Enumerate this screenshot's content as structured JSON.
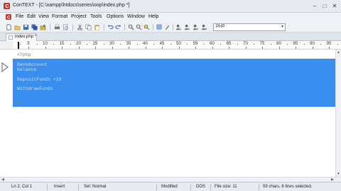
{
  "window": {
    "title": "ConTEXT - [C:\\xampp\\htdocs\\series\\oop\\index.php *]",
    "minimize": "–",
    "maximize": "□",
    "close": "✕"
  },
  "menu": {
    "items": [
      "File",
      "Edit",
      "View",
      "Format",
      "Project",
      "Tools",
      "Options",
      "Window",
      "Help"
    ]
  },
  "toolbar": {
    "icons": [
      "new-file-icon",
      "open-folder-icon",
      "save-icon",
      "save-all-icon",
      "open-project-icon",
      "print-icon",
      "print-preview-icon",
      "cut-icon",
      "copy-icon",
      "paste-icon",
      "undo-icon",
      "redo-icon",
      "find-icon",
      "replace-icon",
      "find-next-icon",
      "exec-icon",
      "user-exec-icon",
      "user-exec-1-icon",
      "user-exec-2-icon",
      "user-exec-3-icon",
      "user-exec-4-icon"
    ],
    "highlighter": {
      "value": "PHP"
    }
  },
  "tabs": [
    {
      "label": "index.php *"
    }
  ],
  "ruler": {
    "labels": [
      "5",
      "10",
      "15",
      "20",
      "25",
      "30",
      "35",
      "40",
      "45",
      "50",
      "55",
      "60",
      "65",
      "70",
      "75",
      "80",
      "85",
      "90",
      "95",
      "10"
    ]
  },
  "editor": {
    "lines": [
      {
        "text": "<?php",
        "selected": false
      },
      {
        "text": "",
        "selected": true
      },
      {
        "text": "BankAccount",
        "selected": true
      },
      {
        "text": "balance",
        "selected": true
      },
      {
        "text": "",
        "selected": true
      },
      {
        "text": "DepositFunds +10",
        "selected": true
      },
      {
        "text": "",
        "selected": true
      },
      {
        "text": "WithdrawFunds",
        "selected": true
      },
      {
        "text": "",
        "selected": false
      },
      {
        "text": "",
        "selected": false
      },
      {
        "text": "?>",
        "selected": false
      }
    ]
  },
  "status": {
    "position": "Ln 2, Col 1",
    "mode": "Insert",
    "sel": "Sel: Normal",
    "modified": "Modified",
    "format": "DOS",
    "filesize": "File size: 11",
    "selection_info": "59 chars, 6 lines selected."
  },
  "colors": {
    "selection": "#3a8ef0",
    "app_icon": "#c0392b"
  }
}
